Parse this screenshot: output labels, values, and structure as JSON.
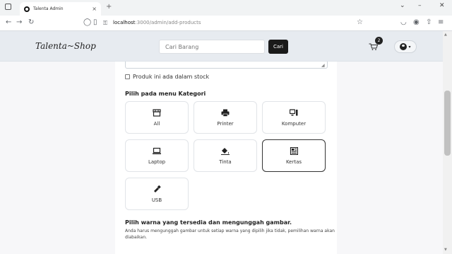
{
  "browser": {
    "tab_title": "Talenta Admin",
    "tab_close": "×",
    "new_tab": "+",
    "url_host": "localhost",
    "url_path": ":3000/admin/add-products"
  },
  "header": {
    "brand": "Talenta~Shop",
    "search_placeholder": "Cari Barang",
    "search_button": "Cari",
    "cart_count": "2"
  },
  "form": {
    "stock_label": "Produk ini ada dalam stock",
    "category_title": "Pilih pada menu Kategori",
    "categories": [
      {
        "label": "All",
        "icon": "store-icon"
      },
      {
        "label": "Printer",
        "icon": "printer-icon"
      },
      {
        "label": "Komputer",
        "icon": "computer-icon"
      },
      {
        "label": "Laptop",
        "icon": "laptop-icon"
      },
      {
        "label": "Tinta",
        "icon": "ink-bucket-icon"
      },
      {
        "label": "Kertas",
        "icon": "newspaper-icon"
      },
      {
        "label": "USB",
        "icon": "usb-icon"
      }
    ],
    "selected_category": "Kertas",
    "color_title": "Pilih warna yang tersedia dan mengunggah gambar.",
    "color_desc": "Anda harus mengunggah gambar untuk setiap warna yang dipilih jika tidak, pemilihan warna akan diabaikan."
  }
}
